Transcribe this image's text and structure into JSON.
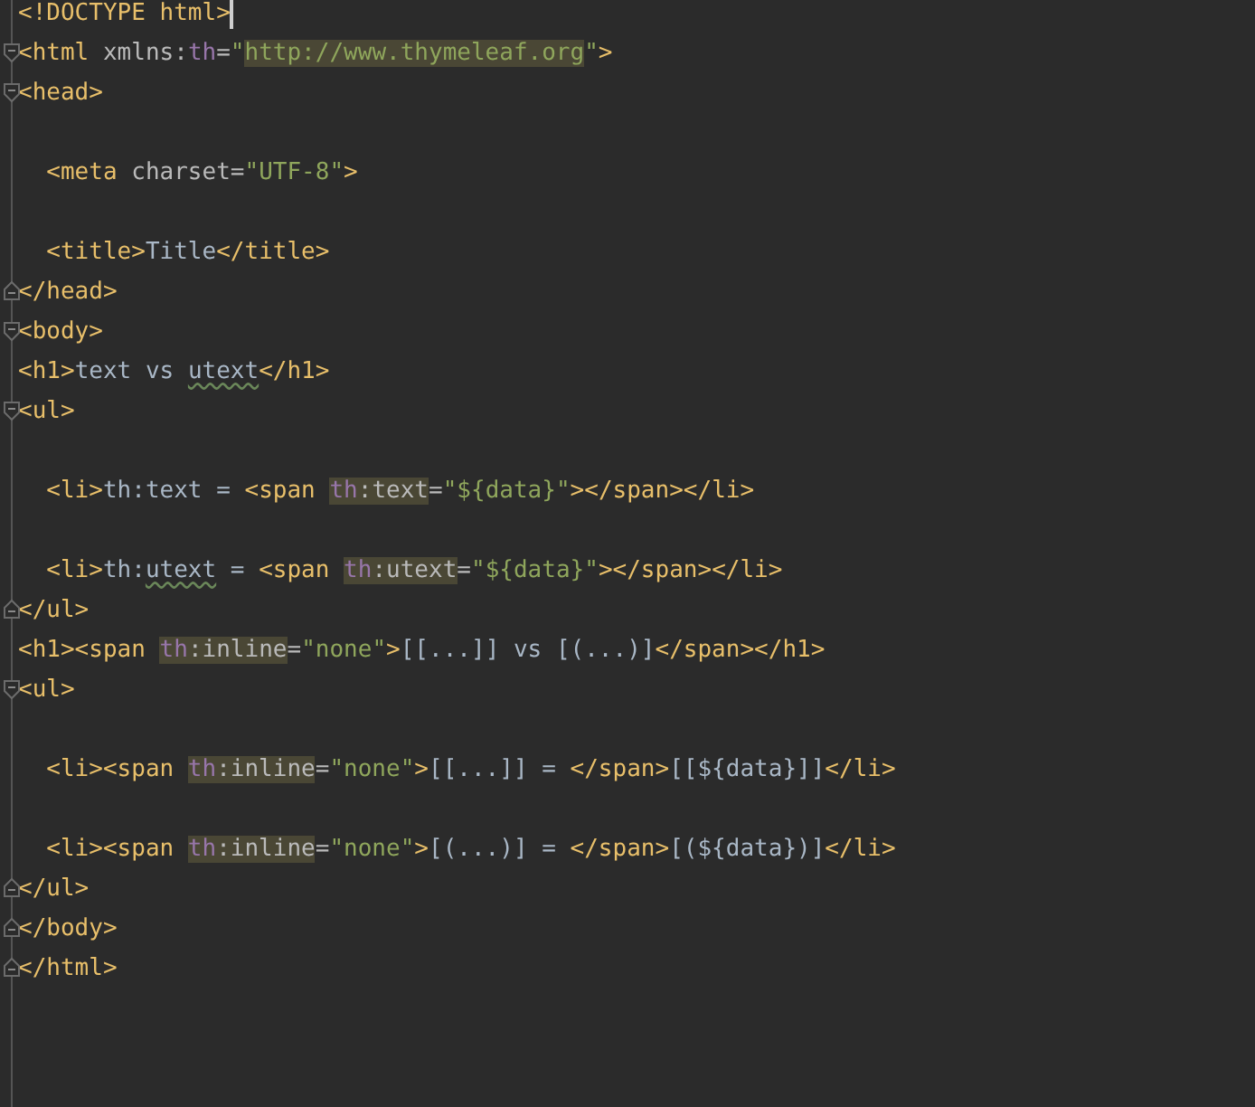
{
  "editor": {
    "lines": [
      {
        "caret": true,
        "segments": [
          {
            "kind": "tag",
            "text": "<!DOCTYPE html>"
          }
        ]
      },
      {
        "caret": false,
        "fold": {
          "kind": "start"
        },
        "segments": [
          {
            "kind": "tag",
            "text": "<html "
          },
          {
            "kind": "attr",
            "text": "xmlns:"
          },
          {
            "kind": "ns",
            "text": "th"
          },
          {
            "kind": "attr",
            "text": "="
          },
          {
            "kind": "string",
            "text": "\""
          },
          {
            "kind": "highlight",
            "children": [
              {
                "kind": "string",
                "text": "http://www.thymeleaf.org"
              }
            ]
          },
          {
            "kind": "string",
            "text": "\""
          },
          {
            "kind": "tag",
            "text": ">"
          }
        ]
      },
      {
        "caret": false,
        "fold": {
          "kind": "start"
        },
        "segments": [
          {
            "kind": "tag",
            "text": "<head>"
          }
        ]
      },
      {
        "caret": false
      },
      {
        "caret": false,
        "segments": [
          {
            "kind": "tag",
            "text": "  <meta "
          },
          {
            "kind": "attr",
            "text": "charset="
          },
          {
            "kind": "string",
            "text": "\"UTF-8\""
          },
          {
            "kind": "tag",
            "text": ">"
          }
        ]
      },
      {
        "caret": false
      },
      {
        "caret": false,
        "segments": [
          {
            "kind": "tag",
            "text": "  <title>"
          },
          {
            "kind": "text",
            "text": "Title"
          },
          {
            "kind": "tag",
            "text": "</title>"
          }
        ]
      },
      {
        "caret": false,
        "fold": {
          "kind": "end"
        },
        "segments": [
          {
            "kind": "tag",
            "text": "</head>"
          }
        ]
      },
      {
        "caret": false,
        "fold": {
          "kind": "start"
        },
        "segments": [
          {
            "kind": "tag",
            "text": "<body>"
          }
        ]
      },
      {
        "caret": false,
        "segments": [
          {
            "kind": "tag",
            "text": "<h1>"
          },
          {
            "kind": "text",
            "text": "text vs "
          },
          {
            "kind": "typo",
            "text": "utext"
          },
          {
            "kind": "tag",
            "text": "</h1>"
          }
        ]
      },
      {
        "caret": false,
        "fold": {
          "kind": "start"
        },
        "segments": [
          {
            "kind": "tag",
            "text": "<ul>"
          }
        ]
      },
      {
        "caret": false
      },
      {
        "caret": false,
        "segments": [
          {
            "kind": "tag",
            "text": "  <li>"
          },
          {
            "kind": "text",
            "text": "th:text = "
          },
          {
            "kind": "tag",
            "text": "<span "
          },
          {
            "kind": "highlight",
            "children": [
              {
                "kind": "ns",
                "text": "th"
              },
              {
                "kind": "attr",
                "text": ":text"
              }
            ]
          },
          {
            "kind": "attr",
            "text": "="
          },
          {
            "kind": "string",
            "text": "\"${data}\""
          },
          {
            "kind": "tag",
            "text": "></span></li>"
          }
        ]
      },
      {
        "caret": false
      },
      {
        "caret": false,
        "segments": [
          {
            "kind": "tag",
            "text": "  <li>"
          },
          {
            "kind": "text",
            "text": "th:"
          },
          {
            "kind": "typo",
            "text": "utext"
          },
          {
            "kind": "text",
            "text": " = "
          },
          {
            "kind": "tag",
            "text": "<span "
          },
          {
            "kind": "highlight",
            "children": [
              {
                "kind": "ns",
                "text": "th"
              },
              {
                "kind": "attr",
                "text": ":utext"
              }
            ]
          },
          {
            "kind": "attr",
            "text": "="
          },
          {
            "kind": "string",
            "text": "\"${data}\""
          },
          {
            "kind": "tag",
            "text": "></span></li>"
          }
        ]
      },
      {
        "caret": false,
        "fold": {
          "kind": "end"
        },
        "segments": [
          {
            "kind": "tag",
            "text": "</ul>"
          }
        ]
      },
      {
        "caret": false,
        "segments": [
          {
            "kind": "tag",
            "text": "<h1><span "
          },
          {
            "kind": "highlight",
            "children": [
              {
                "kind": "ns",
                "text": "th"
              },
              {
                "kind": "attr",
                "text": ":inline"
              }
            ]
          },
          {
            "kind": "attr",
            "text": "="
          },
          {
            "kind": "string",
            "text": "\"none\""
          },
          {
            "kind": "tag",
            "text": ">"
          },
          {
            "kind": "text",
            "text": "[[...]] vs [(...)]"
          },
          {
            "kind": "tag",
            "text": "</span></h1>"
          }
        ]
      },
      {
        "caret": false,
        "fold": {
          "kind": "start"
        },
        "segments": [
          {
            "kind": "tag",
            "text": "<ul>"
          }
        ]
      },
      {
        "caret": false
      },
      {
        "caret": false,
        "segments": [
          {
            "kind": "tag",
            "text": "  <li><span "
          },
          {
            "kind": "highlight",
            "children": [
              {
                "kind": "ns",
                "text": "th"
              },
              {
                "kind": "attr",
                "text": ":inline"
              }
            ]
          },
          {
            "kind": "attr",
            "text": "="
          },
          {
            "kind": "string",
            "text": "\"none\""
          },
          {
            "kind": "tag",
            "text": ">"
          },
          {
            "kind": "text",
            "text": "[[...]] = "
          },
          {
            "kind": "tag",
            "text": "</span>"
          },
          {
            "kind": "text",
            "text": "[[${data}]]"
          },
          {
            "kind": "tag",
            "text": "</li>"
          }
        ]
      },
      {
        "caret": false
      },
      {
        "caret": false,
        "segments": [
          {
            "kind": "tag",
            "text": "  <li><span "
          },
          {
            "kind": "highlight",
            "children": [
              {
                "kind": "ns",
                "text": "th"
              },
              {
                "kind": "attr",
                "text": ":inline"
              }
            ]
          },
          {
            "kind": "attr",
            "text": "="
          },
          {
            "kind": "string",
            "text": "\"none\""
          },
          {
            "kind": "tag",
            "text": ">"
          },
          {
            "kind": "text",
            "text": "[(...)] = "
          },
          {
            "kind": "tag",
            "text": "</span>"
          },
          {
            "kind": "text",
            "text": "[(${data})]"
          },
          {
            "kind": "tag",
            "text": "</li>"
          }
        ]
      },
      {
        "caret": false,
        "fold": {
          "kind": "end"
        },
        "segments": [
          {
            "kind": "tag",
            "text": "</ul>"
          }
        ]
      },
      {
        "caret": false,
        "fold": {
          "kind": "end"
        },
        "segments": [
          {
            "kind": "tag",
            "text": "</body>"
          }
        ]
      },
      {
        "caret": false,
        "fold": {
          "kind": "end"
        },
        "segments": [
          {
            "kind": "tag",
            "text": "</html>"
          }
        ]
      }
    ]
  }
}
